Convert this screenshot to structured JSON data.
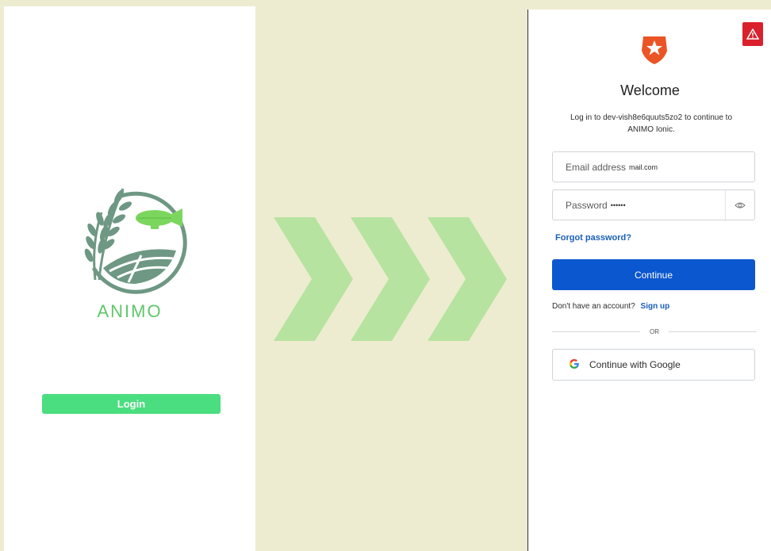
{
  "left_screen": {
    "brand_name": "ANIMO",
    "login_label": "Login"
  },
  "right_screen": {
    "title": "Welcome",
    "subtitle": "Log in to dev-vish8e6quuts5zo2 to continue to ANIMO Ionic.",
    "email": {
      "label": "Email address",
      "value": "mail.com"
    },
    "password": {
      "label": "Password",
      "value": "••••••"
    },
    "forgot_label": "Forgot password?",
    "continue_label": "Continue",
    "no_account_text": "Don't have an account?",
    "signup_label": "Sign up",
    "or_text": "OR",
    "google_label": "Continue with Google"
  },
  "icons": {
    "warning": "warning-triangle-icon",
    "auth0_logo": "auth0-shield-star-icon",
    "eye": "eye-icon",
    "google": "google-g-icon",
    "animo_logo": "wheat-blimp-logo"
  },
  "colors": {
    "background": "#edecd0",
    "brand_green": "#5fc76a",
    "login_green": "#4ade80",
    "arrow_green": "#b7e3a1",
    "continue_blue": "#0b57d0",
    "link_blue": "#1a5fb8",
    "auth0_orange": "#eb5424",
    "warning_red": "#d9202c"
  }
}
